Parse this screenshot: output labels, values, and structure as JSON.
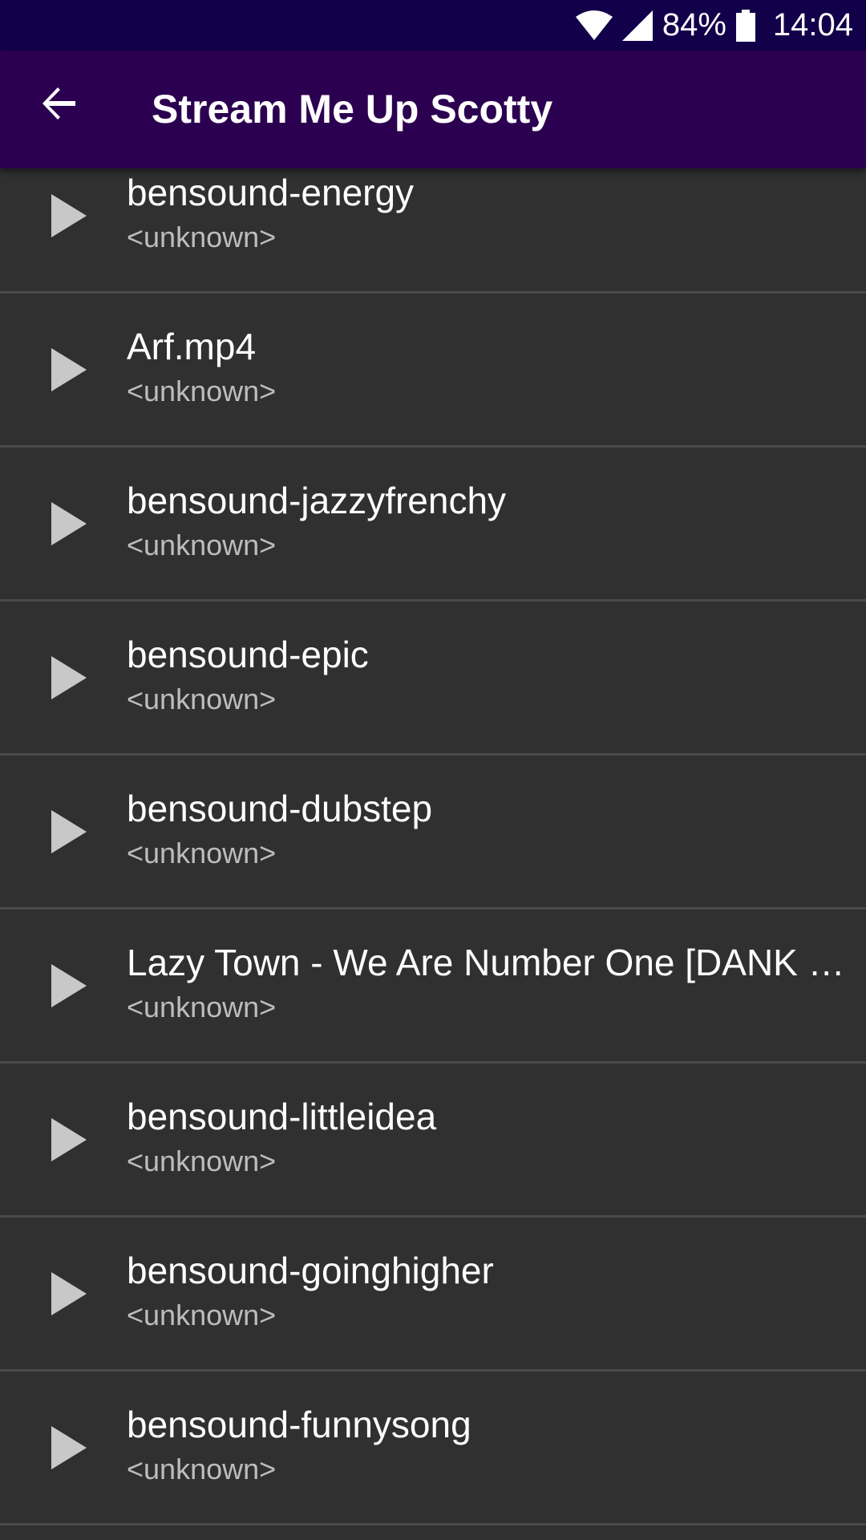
{
  "status_bar": {
    "battery": "84%",
    "time": "14:04",
    "icons": [
      "wifi-icon",
      "cellular-signal-icon",
      "battery-icon"
    ]
  },
  "app_bar": {
    "title": "Stream Me Up Scotty",
    "back_icon": "arrow-back-icon"
  },
  "colors": {
    "status_bar_bg": "#12004a",
    "app_bar_bg": "#2c0050",
    "list_bg": "#303030",
    "divider": "#4a4a4a",
    "play_icon": "#c8c8c8",
    "title_text": "#ffffff",
    "subtitle_text": "#bdbdbd"
  },
  "tracks": [
    {
      "title": "bensound-energy",
      "artist": "<unknown>"
    },
    {
      "title": "Arf.mp4",
      "artist": "<unknown>"
    },
    {
      "title": "bensound-jazzyfrenchy",
      "artist": "<unknown>"
    },
    {
      "title": "bensound-epic",
      "artist": "<unknown>"
    },
    {
      "title": "bensound-dubstep",
      "artist": "<unknown>"
    },
    {
      "title": "Lazy Town - We Are Number One [DANK E…",
      "artist": "<unknown>"
    },
    {
      "title": "bensound-littleidea",
      "artist": "<unknown>"
    },
    {
      "title": "bensound-goinghigher",
      "artist": "<unknown>"
    },
    {
      "title": "bensound-funnysong",
      "artist": "<unknown>"
    }
  ]
}
